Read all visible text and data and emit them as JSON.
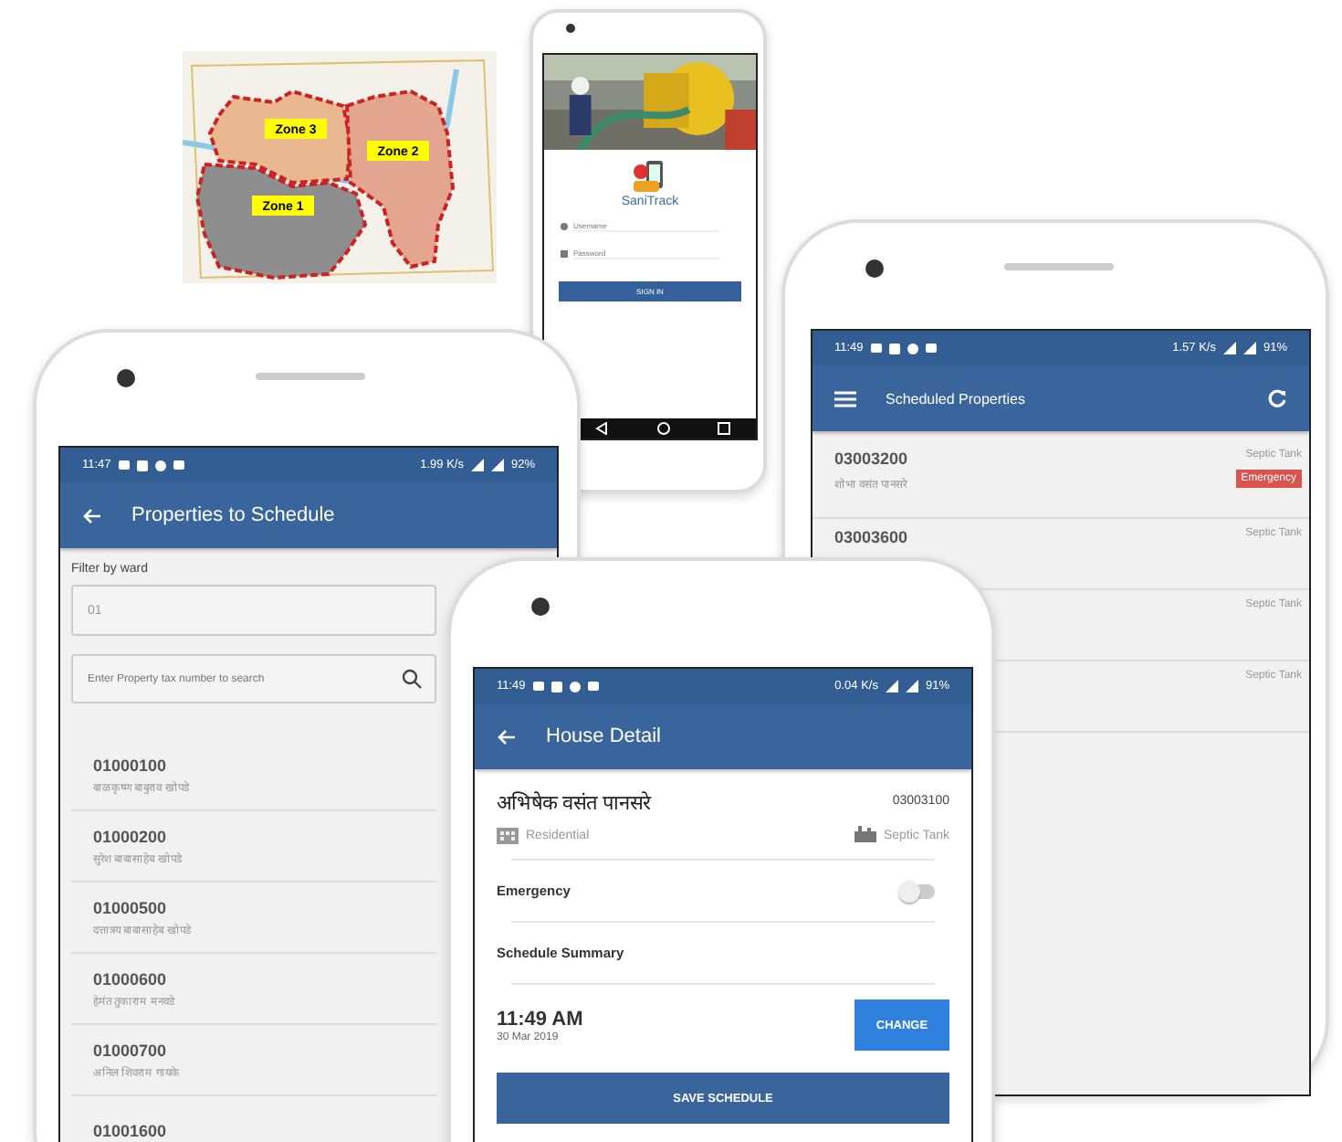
{
  "map": {
    "zones": [
      {
        "label": "Zone 3",
        "color": "#e9b890"
      },
      {
        "label": "Zone 2",
        "color": "#e3a58f"
      },
      {
        "label": "Zone 1",
        "color": "#8e8e8e"
      }
    ]
  },
  "login_screen": {
    "app_name": "SaniTrack",
    "username": {
      "placeholder": "Username"
    },
    "password": {
      "placeholder": "Password"
    },
    "button": "SIGN IN"
  },
  "properties_screen": {
    "status_bar": {
      "time": "11:47",
      "speed": "1.99 K/s",
      "battery": "92%"
    },
    "title": "Properties to Schedule",
    "filter_label": "Filter by ward",
    "ward_field": {
      "value": "01"
    },
    "search": {
      "placeholder": "Enter Property tax number to search"
    },
    "rows": [
      {
        "id": "01000100",
        "name": "बाळकृष्ण बाबुराव खोपडे"
      },
      {
        "id": "01000200",
        "name": "सुरेश बाबासाहेब खोपडे"
      },
      {
        "id": "01000500",
        "name": "दत्तात्रय बाबासाहेब खोपडे"
      },
      {
        "id": "01000600",
        "name": "हेमंत तुकाराम मनवडे"
      },
      {
        "id": "01000700",
        "name": "अनिल शिवराम गायके"
      },
      {
        "id": "01001600"
      }
    ]
  },
  "scheduled_screen": {
    "status_bar": {
      "time": "11:49",
      "speed": "1.57 K/s",
      "battery": "91%"
    },
    "title": "Scheduled Properties",
    "rows": [
      {
        "id": "03003200",
        "name": "शोभा वसंत पानसरे",
        "type": "Septic Tank",
        "badge": "Emergency"
      },
      {
        "id": "03003600",
        "type": "Septic Tank"
      },
      {
        "type": "Septic Tank"
      },
      {
        "type": "Septic Tank"
      }
    ]
  },
  "house_detail_screen": {
    "status_bar": {
      "time": "11:49",
      "speed": "0.04 K/s",
      "battery": "91%"
    },
    "title": "House Detail",
    "owner": "अभिषेक वसंत पानसरे",
    "property_id": "03003100",
    "category": "Residential",
    "sanitation": "Septic Tank",
    "emergency": {
      "label": "Emergency",
      "on": false
    },
    "section": "Schedule Summary",
    "time": "11:49 AM",
    "date": "30 Mar 2019",
    "change_button": "CHANGE",
    "save_button": "SAVE SCHEDULE"
  }
}
